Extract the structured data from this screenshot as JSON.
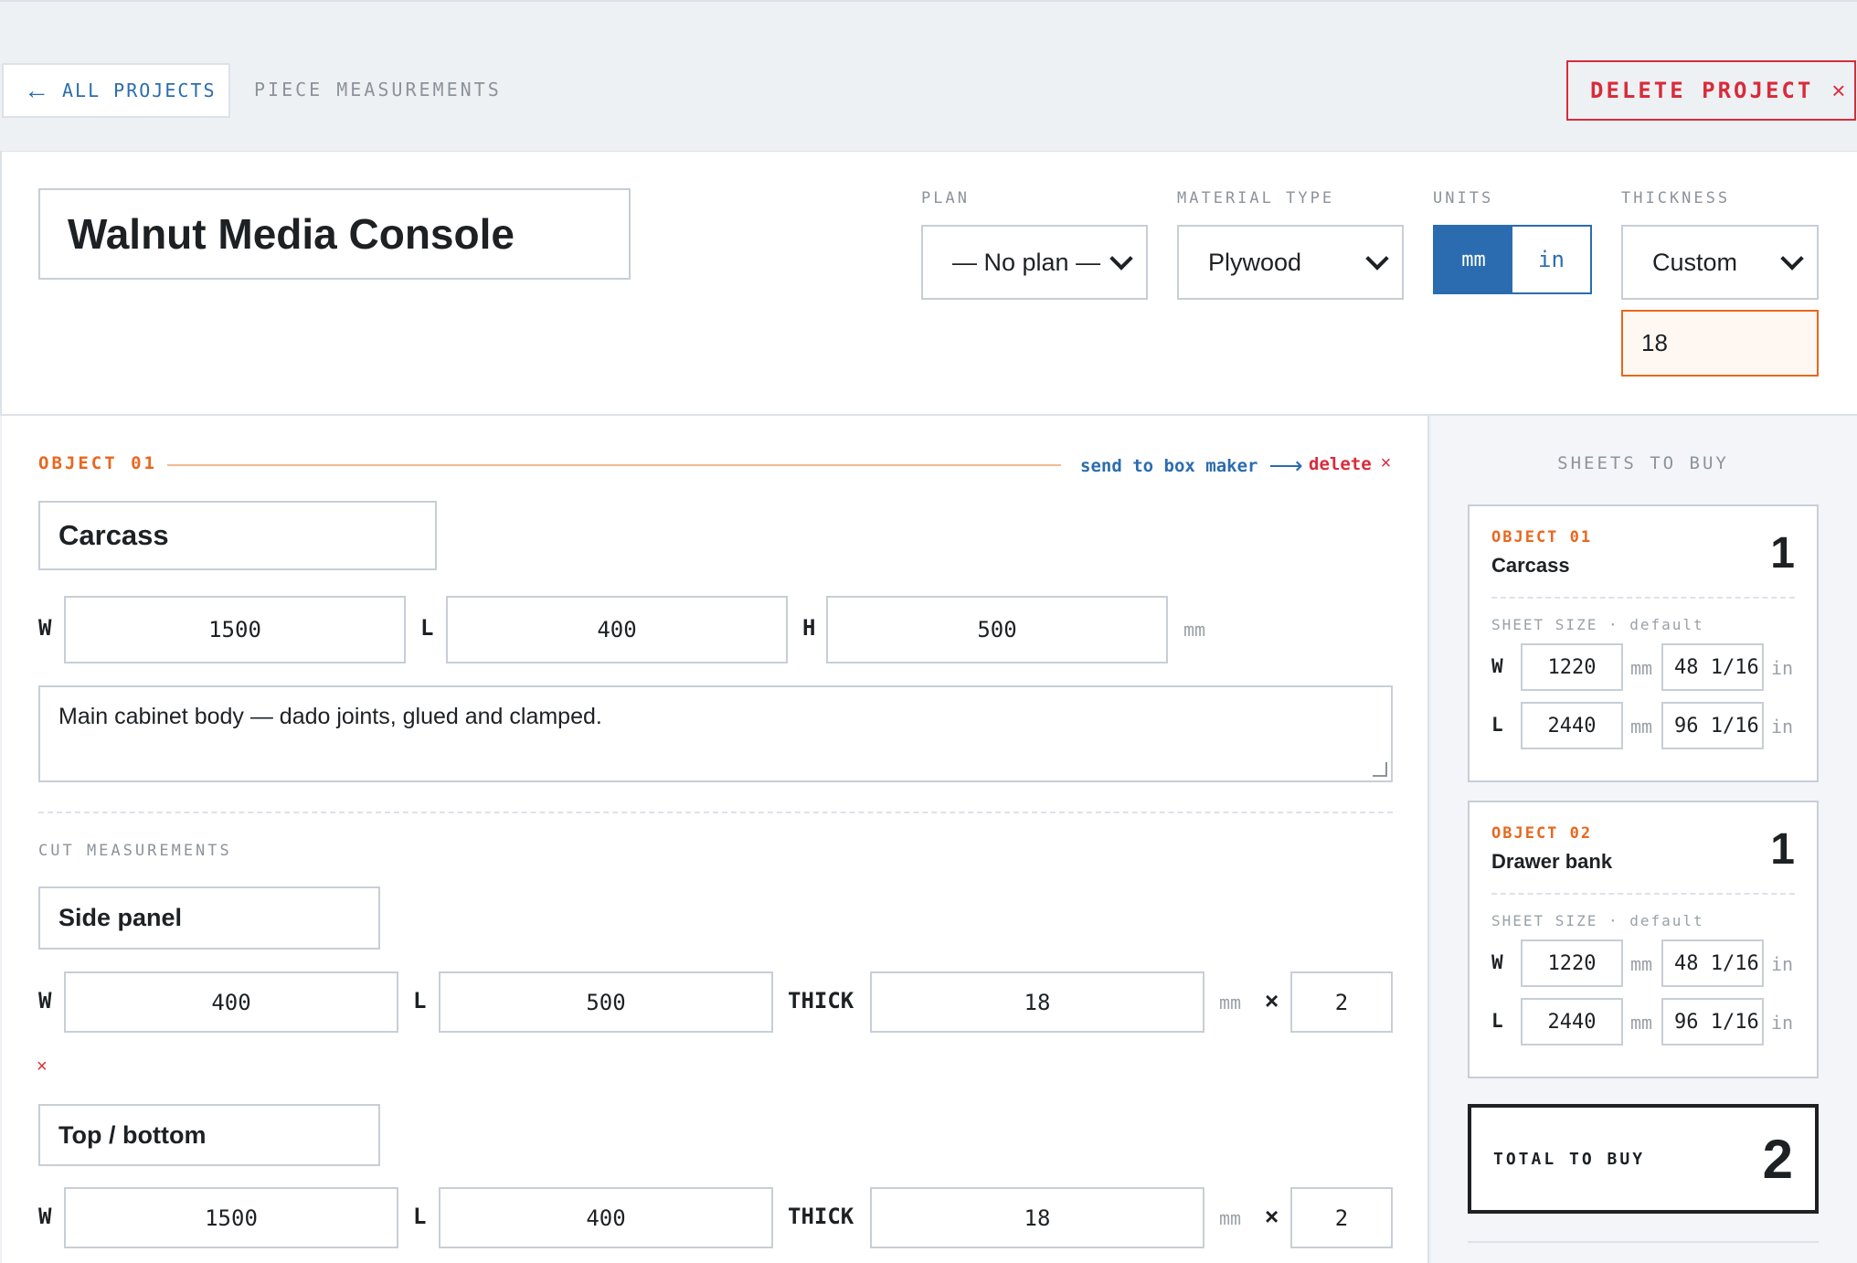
{
  "nav": {
    "back_arrow": "←",
    "back_label": "ALL PROJECTS",
    "crumb": "PIECE MEASUREMENTS",
    "delete_label": "DELETE PROJECT",
    "delete_icon": "×"
  },
  "project": {
    "name": "Walnut Media Console",
    "plan_label": "PLAN",
    "plan_value": "— No plan —",
    "material_label": "MATERIAL TYPE",
    "material_value": "Plywood",
    "units_label": "UNITS",
    "units_options": [
      "mm",
      "in"
    ],
    "units_selected": "mm",
    "thickness_label": "THICKNESS",
    "thickness_value": "Custom",
    "thickness_custom": "18"
  },
  "object": {
    "tag": "OBJECT 01",
    "send_label": "send to box maker",
    "send_arrow": "⟶",
    "delete_label": "delete",
    "delete_icon": "×",
    "name": "Carcass",
    "w_label": "W",
    "w": "1500",
    "l_label": "L",
    "l": "400",
    "h_label": "H",
    "h": "500",
    "unit": "mm",
    "notes": "Main cabinet body — dado joints, glued and clamped.",
    "cuts_label": "CUT MEASUREMENTS",
    "cuts": [
      {
        "name": "Side panel",
        "w_label": "W",
        "w": "400",
        "l_label": "L",
        "l": "500",
        "thick_label": "THICK",
        "thick": "18",
        "unit": "mm",
        "times": "×",
        "qty": "2",
        "remove": "×"
      },
      {
        "name": "Top / bottom",
        "w_label": "W",
        "w": "1500",
        "l_label": "L",
        "l": "400",
        "thick_label": "THICK",
        "thick": "18",
        "unit": "mm",
        "times": "×",
        "qty": "2"
      }
    ]
  },
  "sidebar": {
    "title": "SHEETS TO BUY",
    "cards": [
      {
        "tag": "OBJECT 01",
        "name": "Carcass",
        "count": "1",
        "sheet_label": "SHEET SIZE · default",
        "w_label": "W",
        "w_mm": "1220",
        "w_in": "48 1/16",
        "l_label": "L",
        "l_mm": "2440",
        "l_in": "96 1/16",
        "mm": "mm",
        "in": "in"
      },
      {
        "tag": "OBJECT 02",
        "name": "Drawer bank",
        "count": "1",
        "sheet_label": "SHEET SIZE · default",
        "w_label": "W",
        "w_mm": "1220",
        "w_in": "48 1/16",
        "l_label": "L",
        "l_mm": "2440",
        "l_in": "96 1/16",
        "mm": "mm",
        "in": "in"
      }
    ],
    "total_label": "TOTAL TO BUY",
    "total_value": "2"
  },
  "colors": {
    "accent_blue": "#2b6cb0",
    "accent_orange": "#e8671e",
    "danger_red": "#d92b3a"
  }
}
